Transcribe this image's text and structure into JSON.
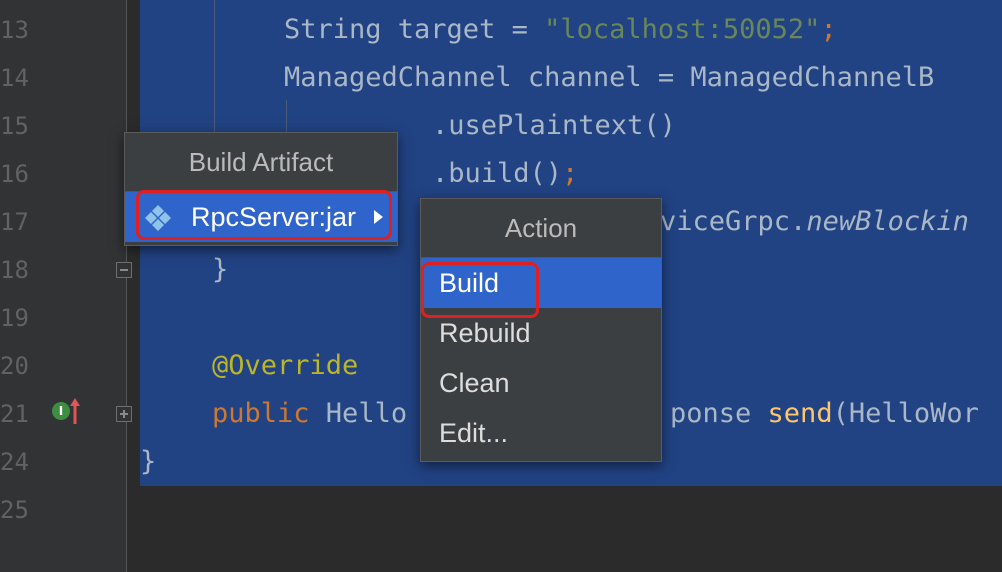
{
  "gutter": {
    "line_numbers": [
      "13",
      "14",
      "15",
      "16",
      "17",
      "18",
      "19",
      "20",
      "21",
      "24",
      "25"
    ]
  },
  "code": {
    "line13": {
      "pre": "String target = ",
      "str": "\"localhost:50052\"",
      "end": ";"
    },
    "line14": {
      "text": "ManagedChannel channel = ManagedChannelB"
    },
    "line15": {
      "text": ".usePlaintext()"
    },
    "line16": {
      "text": ".build()",
      "end": ";"
    },
    "line17": {
      "pre": "viceGrpc.",
      "italic": "newBlockin"
    },
    "line18": {
      "text": "}"
    },
    "line20": {
      "annotation": "@Override"
    },
    "line21": {
      "kw": "public",
      "mid1": " Hello",
      "mid2": "ponse ",
      "fn": "send",
      "rest": "(HelloWor"
    },
    "line24": {
      "text": "}"
    }
  },
  "build_artifact_menu": {
    "title": "Build Artifact",
    "items": [
      {
        "label": "RpcServer:jar",
        "icon": "artifact-diamond-icon",
        "has_submenu": true
      }
    ]
  },
  "action_menu": {
    "title": "Action",
    "items": [
      {
        "label": "Build"
      },
      {
        "label": "Rebuild"
      },
      {
        "label": "Clean"
      },
      {
        "label": "Edit..."
      }
    ]
  },
  "gutter_icons": {
    "implements_badge": "I"
  },
  "colors": {
    "selection_background": "#214283",
    "menu_selected": "#2f65ca",
    "highlight_outline": "#e02020"
  }
}
